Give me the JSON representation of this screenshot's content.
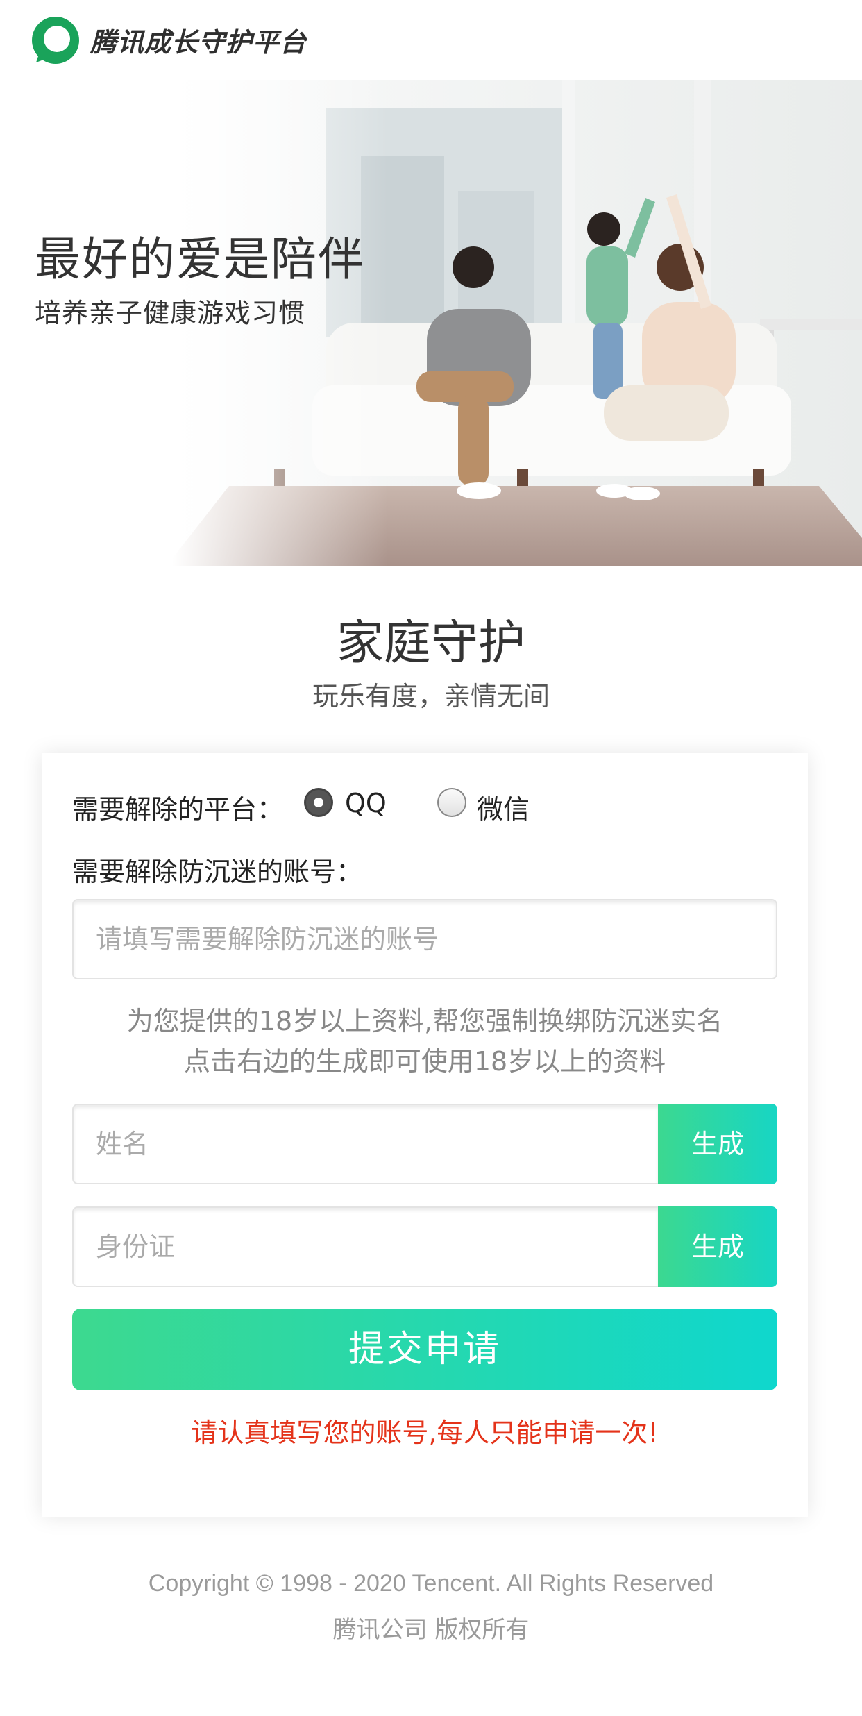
{
  "header": {
    "logo_text": "腾讯成长守护平台",
    "brand_color": "#1aa35a"
  },
  "hero": {
    "title": "最好的爱是陪伴",
    "subtitle": "培养亲子健康游戏习惯"
  },
  "main": {
    "title": "家庭守护",
    "subtitle": "玩乐有度，亲情无间"
  },
  "form": {
    "platform_label": "需要解除的平台：",
    "platform_options": [
      {
        "label": "QQ",
        "selected": true
      },
      {
        "label": "微信",
        "selected": false
      }
    ],
    "account_label": "需要解除防沉迷的账号：",
    "account_placeholder": "请填写需要解除防沉迷的账号",
    "hint_line1": "为您提供的18岁以上资料,帮您强制换绑防沉迷实名",
    "hint_line2": "点击右边的生成即可使用18岁以上的资料",
    "name_placeholder": "姓名",
    "id_placeholder": "身份证",
    "generate_label": "生成",
    "submit_label": "提交申请",
    "warning": "请认真填写您的账号,每人只能申请一次!",
    "accent_color": "#19d6b8",
    "warning_color": "#e4331a"
  },
  "footer": {
    "copyright": "Copyright © 1998 - 2020 Tencent. All Rights Reserved",
    "company": "腾讯公司 版权所有"
  }
}
